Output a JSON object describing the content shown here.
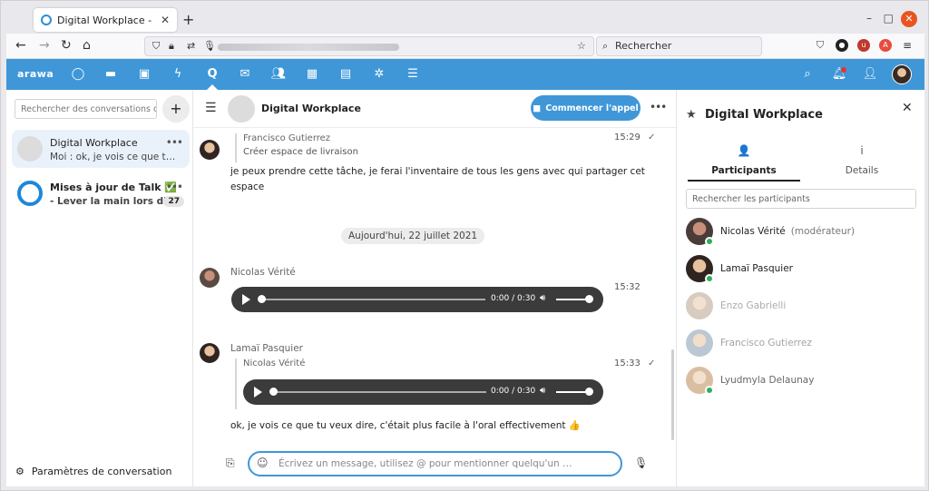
{
  "browser": {
    "tab_title": "Digital Workplace - Discu",
    "tab_close": "✕",
    "new_tab": "+",
    "search_placeholder": "Rechercher",
    "minimize": "–",
    "maximize": "□",
    "close": "✕"
  },
  "app": {
    "logo": "arawa",
    "accent_color": "#3f97d8"
  },
  "left": {
    "search_placeholder": "Rechercher des conversations ou de",
    "add_label": "+",
    "conversations": [
      {
        "name": "Digital Workplace",
        "preview": "Moi : ok, je vois ce que tu ve...",
        "dots": "•••"
      },
      {
        "name": "Mises à jour de Talk ✅",
        "preview": "- Lever la main lors d'u...",
        "dots": "•••",
        "badge": "27"
      }
    ],
    "settings_label": "Paramètres de conversation"
  },
  "chat": {
    "title": "Digital Workplace",
    "call_label": "Commencer l'appel",
    "more": "•••",
    "messages": [
      {
        "quote_author": "Francisco Gutierrez",
        "quote_text": "Créer espace de livraison",
        "text_line1": "je peux prendre cette tâche, je ferai l'inventaire de tous les gens avec qui partager cet",
        "text_line2": "espace",
        "time": "15:29",
        "check": "✓"
      },
      {
        "author": "Nicolas Vérité",
        "time": "15:32",
        "audio_time": "0:00 / 0:30"
      },
      {
        "author": "Lamaï Pasquier",
        "quote_author": "Nicolas Vérité",
        "audio_time": "0:00 / 0:30",
        "text": "ok, je vois ce que tu veux dire, c'était plus facile à l'oral effectivement 👍",
        "time": "15:33",
        "check": "✓"
      }
    ],
    "date_separator": "Aujourd'hui, 22 juillet 2021",
    "composer_placeholder": "Écrivez un message, utilisez @ pour mentionner quelqu'un …"
  },
  "right": {
    "title": "Digital Workplace",
    "close": "✕",
    "tabs": [
      {
        "label": "Participants",
        "icon": "👤"
      },
      {
        "label": "Details",
        "icon": "i"
      }
    ],
    "search_placeholder": "Rechercher les participants",
    "participants": [
      {
        "name": "Nicolas Vérité",
        "role": "(modérateur)",
        "online": true
      },
      {
        "name": "Lamaï Pasquier",
        "role": "",
        "online": true
      },
      {
        "name": "Enzo Gabrielli",
        "role": "",
        "online": false
      },
      {
        "name": "Francisco Gutierrez",
        "role": "",
        "online": false
      },
      {
        "name": "Lyudmyla Delaunay",
        "role": "",
        "online": true
      }
    ]
  }
}
